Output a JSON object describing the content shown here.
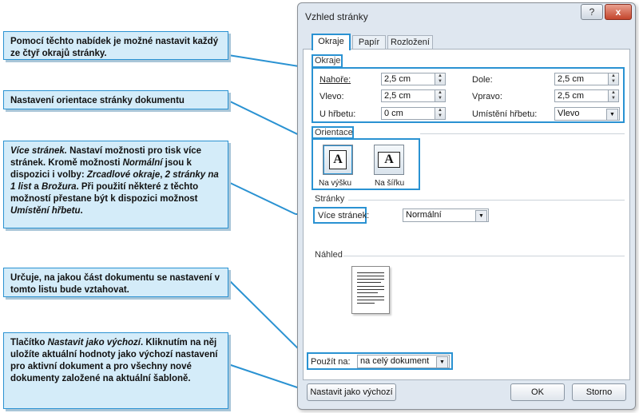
{
  "callouts": {
    "c1": "Pomocí těchto nabídek je možné nastavit každý ze čtyř okrajů stránky.",
    "c2": "Nastavení orientace stránky dokumentu",
    "c3": {
      "p1": "Více stránek.",
      "p2": " Nastaví možnosti pro tisk více stránek. Kromě možnosti ",
      "p3": "Normální",
      "p4": " jsou k dispozici i volby: ",
      "p5": "Zrcadlové okraje",
      "p6": ", ",
      "p7": "2 stránky na 1 list",
      "p8": " a ",
      "p9": "Brožura",
      "p10": ". Při použití některé z těchto možností přestane být k dispozici možnost ",
      "p11": "Umístění hřbetu",
      "p12": "."
    },
    "c4": "Určuje, na jakou část dokumentu se nastavení v tomto listu bude vztahovat.",
    "c5": {
      "p1": "Tlačítko ",
      "p2": "Nastavit jako výchozí",
      "p3": ". Kliknutím na něj uložíte aktuální hodnoty jako výchozí nastavení pro aktivní dokument a pro všechny nové dokumenty založené na aktuální šabloně."
    }
  },
  "dialog": {
    "title": "Vzhled stránky",
    "help_label": "?",
    "close_label": "x",
    "tabs": [
      "Okraje",
      "Papír",
      "Rozložení"
    ],
    "margins": {
      "section": "Okraje",
      "top_label": "Nahoře:",
      "top_value": "2,5 cm",
      "bottom_label": "Dole:",
      "bottom_value": "2,5 cm",
      "left_label": "Vlevo:",
      "left_value": "2,5 cm",
      "right_label": "Vpravo:",
      "right_value": "2,5 cm",
      "gutter_label": "U hřbetu:",
      "gutter_value": "0 cm",
      "gutter_pos_label": "Umístění hřbetu:",
      "gutter_pos_value": "Vlevo"
    },
    "orientation": {
      "section": "Orientace",
      "glyph": "A",
      "portrait": "Na výšku",
      "landscape": "Na šířku"
    },
    "pages": {
      "section": "Stránky",
      "multiple_label": "Více stránek:",
      "multiple_value": "Normální"
    },
    "preview": {
      "section": "Náhled"
    },
    "apply": {
      "label": "Použít na:",
      "value": "na celý dokument"
    },
    "buttons": {
      "default": "Nastavit jako výchozí",
      "ok": "OK",
      "cancel": "Storno"
    }
  }
}
